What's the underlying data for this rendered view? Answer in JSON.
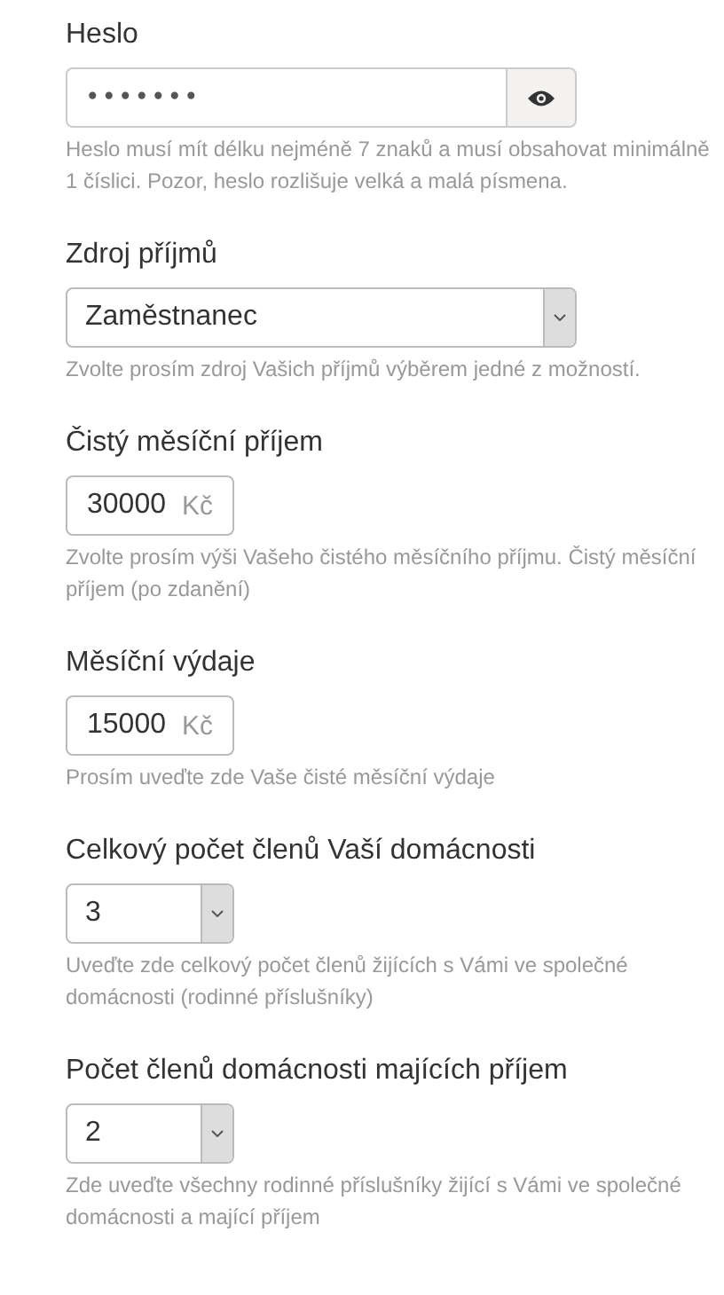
{
  "fields": [
    {
      "kind": "password",
      "label": "Heslo",
      "value": "•••••••",
      "help": "Heslo musí mít délku nejméně 7 znaků a musí obsahovat minimálně 1 číslici. Pozor, heslo rozlišuje velká a malá písmena."
    },
    {
      "kind": "select",
      "label": "Zdroj příjmů",
      "value": "Zaměstnanec",
      "help": "Zvolte prosím zdroj Vašich příjmů výběrem jedné z možností."
    },
    {
      "kind": "money",
      "label": "Čistý měsíční příjem",
      "value": "30000",
      "unit": "Kč",
      "help": "Zvolte prosím výši Vašeho čistého měsíčního příjmu. Čistý měsíční příjem (po zdanění)"
    },
    {
      "kind": "money",
      "label": "Měsíční výdaje",
      "value": "15000",
      "unit": "Kč",
      "help": "Prosím uveďte zde Vaše čisté měsíční výdaje"
    },
    {
      "kind": "small-select",
      "label": "Celkový počet členů Vaší domácnosti",
      "value": "3",
      "help": "Uveďte zde celkový počet členů žijících s Vámi ve společné domácnosti (rodinné příslušníky)"
    },
    {
      "kind": "small-select",
      "label": "Počet členů domácnosti majících příjem",
      "value": "2",
      "help": "Zde uveďte všechny rodinné příslušníky žijící s Vámi ve společné domácnosti a mající příjem"
    }
  ]
}
